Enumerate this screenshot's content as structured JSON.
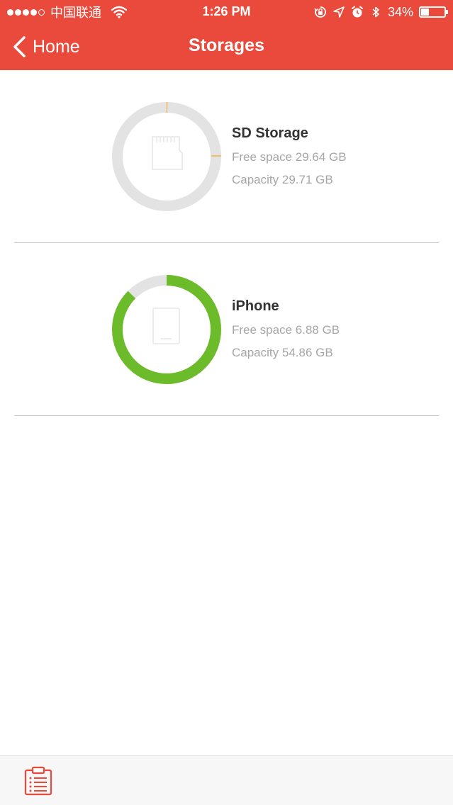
{
  "status_bar": {
    "signal_filled": 4,
    "signal_total": 5,
    "carrier": "中国联通",
    "time": "1:26 PM",
    "battery_percent_text": "34%",
    "battery_level": 0.34,
    "icons": [
      "wifi-icon",
      "orientation-lock-icon",
      "location-icon",
      "alarm-icon",
      "bluetooth-icon",
      "battery-icon"
    ]
  },
  "nav": {
    "back_label": "Home",
    "title": "Storages",
    "back_icon": "chevron-left-icon"
  },
  "storages": [
    {
      "name": "SD Storage",
      "free_space": "Free space 29.64 GB",
      "capacity": "Capacity 29.71 GB",
      "used_fraction": 0.0024,
      "icon": "sd-card-icon"
    },
    {
      "name": "iPhone",
      "free_space": "Free space 6.88 GB",
      "capacity": "Capacity 54.86 GB",
      "used_fraction": 0.8746,
      "icon": "phone-icon"
    }
  ],
  "toolbar": {
    "icon": "clipboard-list-icon"
  },
  "colors": {
    "accent": "#e94a3c",
    "ring_track": "#e3e3e3",
    "sd_used": "#f5a623",
    "phone_used": "#6cbb2a",
    "secondary_text": "#a6a6a6",
    "primary_text": "#333333"
  }
}
